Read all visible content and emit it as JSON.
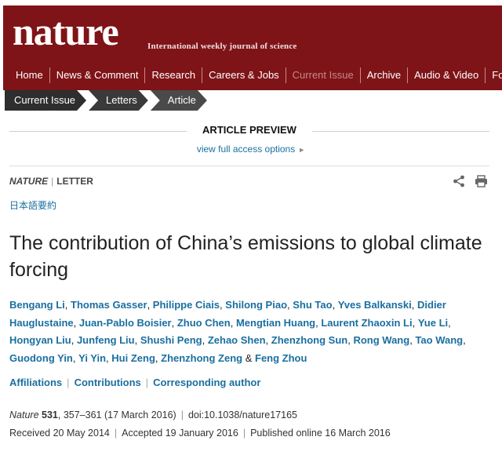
{
  "header": {
    "logo": "nature",
    "tagline": "International weekly journal of science",
    "nav": [
      {
        "label": "Home",
        "current": false
      },
      {
        "label": "News & Comment",
        "current": false
      },
      {
        "label": "Research",
        "current": false
      },
      {
        "label": "Careers & Jobs",
        "current": false
      },
      {
        "label": "Current Issue",
        "current": true
      },
      {
        "label": "Archive",
        "current": false
      },
      {
        "label": "Audio & Video",
        "current": false
      },
      {
        "label": "For A",
        "current": false
      }
    ],
    "colors": {
      "masthead": "#7e1418",
      "current_nav": "#c9888a"
    }
  },
  "breadcrumb": [
    "Current Issue",
    "Letters",
    "Article"
  ],
  "preview": {
    "title": "ARTICLE PREVIEW",
    "full_access": "view full access options"
  },
  "article": {
    "journal": "NATURE",
    "type": "LETTER",
    "japanese_summary": "日本語要約",
    "title": "The contribution of China’s emissions to global climate forcing",
    "authors": [
      "Bengang Li",
      "Thomas Gasser",
      "Philippe Ciais",
      "Shilong Piao",
      "Shu Tao",
      "Yves Balkanski",
      "Didier Hauglustaine",
      "Juan-Pablo Boisier",
      "Zhuo Chen",
      "Mengtian Huang",
      "Laurent Zhaoxin Li",
      "Yue Li",
      "Hongyan Liu",
      "Junfeng Liu",
      "Shushi Peng",
      "Zehao Shen",
      "Zhenzhong Sun",
      "Rong Wang",
      "Tao Wang",
      "Guodong Yin",
      "Yi Yin",
      "Hui Zeng",
      "Zhenzhong Zeng",
      "Feng Zhou"
    ],
    "links": [
      "Affiliations",
      "Contributions",
      "Corresponding author"
    ],
    "citation": {
      "journal": "Nature",
      "volume": "531",
      "pages": "357–361",
      "date": "(17 March 2016)",
      "doi": "doi:10.1038/nature17165"
    },
    "dates": {
      "received": "Received 20 May 2014",
      "accepted": "Accepted 19 January 2016",
      "published": "Published online 16 March 2016"
    },
    "icons": [
      "share-icon",
      "print-icon"
    ],
    "link_color": "#1a6fa0"
  }
}
